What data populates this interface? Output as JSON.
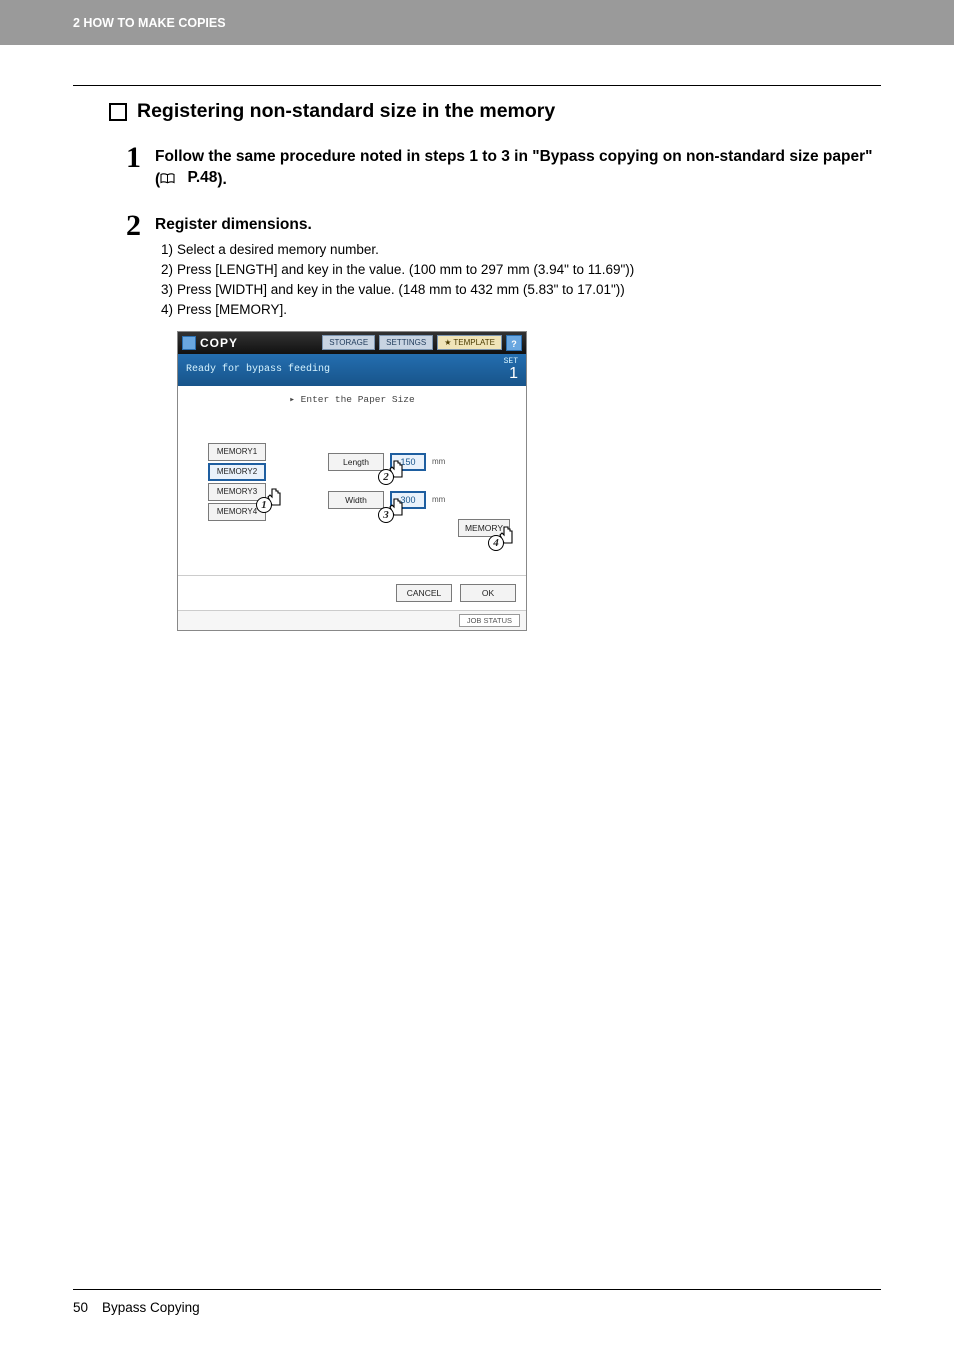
{
  "header": {
    "chapter": "2 HOW TO MAKE COPIES"
  },
  "section": {
    "title": "Registering non-standard size in the memory"
  },
  "steps": [
    {
      "num": "1",
      "head_a": "Follow the same procedure noted in steps 1 to 3 in \"Bypass copying on non-standard size paper\" (",
      "head_ref": "P.48",
      "head_b": ")."
    },
    {
      "num": "2",
      "head": "Register dimensions.",
      "subs": [
        {
          "idx": "1)",
          "text": "Select a desired memory number."
        },
        {
          "idx": "2)",
          "text": "Press [LENGTH] and key in the value. (100 mm to 297 mm (3.94\" to 11.69\"))"
        },
        {
          "idx": "3)",
          "text": "Press [WIDTH] and key in the value. (148 mm to 432 mm (5.83\" to 17.01\"))"
        },
        {
          "idx": "4)",
          "text": "Press [MEMORY]."
        }
      ]
    }
  ],
  "panel": {
    "title": "COPY",
    "tabs": {
      "storage": "STORAGE",
      "settings": "SETTINGS",
      "template": "TEMPLATE"
    },
    "help": "?",
    "status": "Ready for bypass feeding",
    "set_label": "SET",
    "set_count": "1",
    "prompt": "▸ Enter the Paper Size",
    "memory_buttons": [
      "MEMORY1",
      "MEMORY2",
      "MEMORY3",
      "MEMORY4"
    ],
    "length_label": "Length",
    "width_label": "Width",
    "length_value": "150",
    "width_value": "300",
    "unit": "mm",
    "memory_set": "MEMORY",
    "cancel": "CANCEL",
    "ok": "OK",
    "job_status": "JOB STATUS"
  },
  "callouts": {
    "c1": "1",
    "c2": "2",
    "c3": "3",
    "c4": "4"
  },
  "footer": {
    "page": "50",
    "title": "Bypass Copying"
  }
}
